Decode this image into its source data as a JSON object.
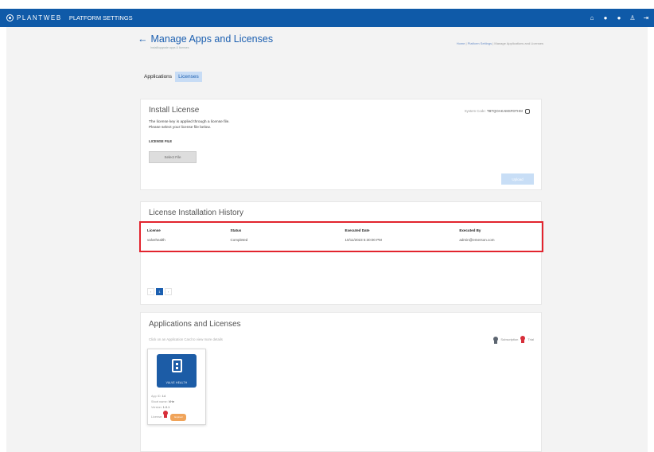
{
  "app": {
    "brand": "PLANTWEB",
    "title": "PLATFORM SETTINGS",
    "top_icons": [
      "home-icon",
      "notification-icon",
      "help-icon",
      "user-icon",
      "logout-icon"
    ]
  },
  "header": {
    "title": "Manage Apps and Licenses",
    "subtitle": "Install/upgrade apps & licenses",
    "breadcrumb": [
      "Home",
      "Platform Settings",
      "Manage Applications and Licenses"
    ]
  },
  "tabs": [
    {
      "label": "Applications",
      "active": false
    },
    {
      "label": "Licenses",
      "active": true
    }
  ],
  "install": {
    "title": "Install License",
    "system_code_label": "System Code:",
    "system_code_value": "TBTQOAKAMSFDTHM",
    "desc_line1": "The license key is applied through a license file.",
    "desc_line2": "Please select your license file below.",
    "file_label": "LICENSE FILE",
    "select_button": "Select File",
    "upload_button": "Upload"
  },
  "history": {
    "title": "License Installation History",
    "columns": [
      "License",
      "Status",
      "Executed Date",
      "Executed By"
    ],
    "rows": [
      [
        "valvehealth",
        "Completed",
        "10/11/2023 5:30:00 PM",
        "admin@emerson.com"
      ]
    ],
    "pagination": {
      "prev": "‹",
      "current": "1",
      "next": "›"
    }
  },
  "apps": {
    "title": "Applications and Licenses",
    "hint": "Click on an Application Card to view more details",
    "legend": [
      {
        "label": "Subscription",
        "color": "#5c6570"
      },
      {
        "label": "Trial",
        "color": "#d72f3a"
      }
    ],
    "card": {
      "name": "VALVE HEALTH",
      "app_id_label": "App ID:",
      "app_id": "14",
      "short_name_label": "Short name:",
      "short_name": "VHe",
      "version_label": "Version:",
      "version": "1.0.1",
      "license_label": "License:",
      "license_badge": "Expired"
    }
  },
  "colors": {
    "topbar": "#0f5aa8",
    "accent": "#1b5fb0",
    "highlight": "#e2242e",
    "badge": "#f0a45a"
  }
}
